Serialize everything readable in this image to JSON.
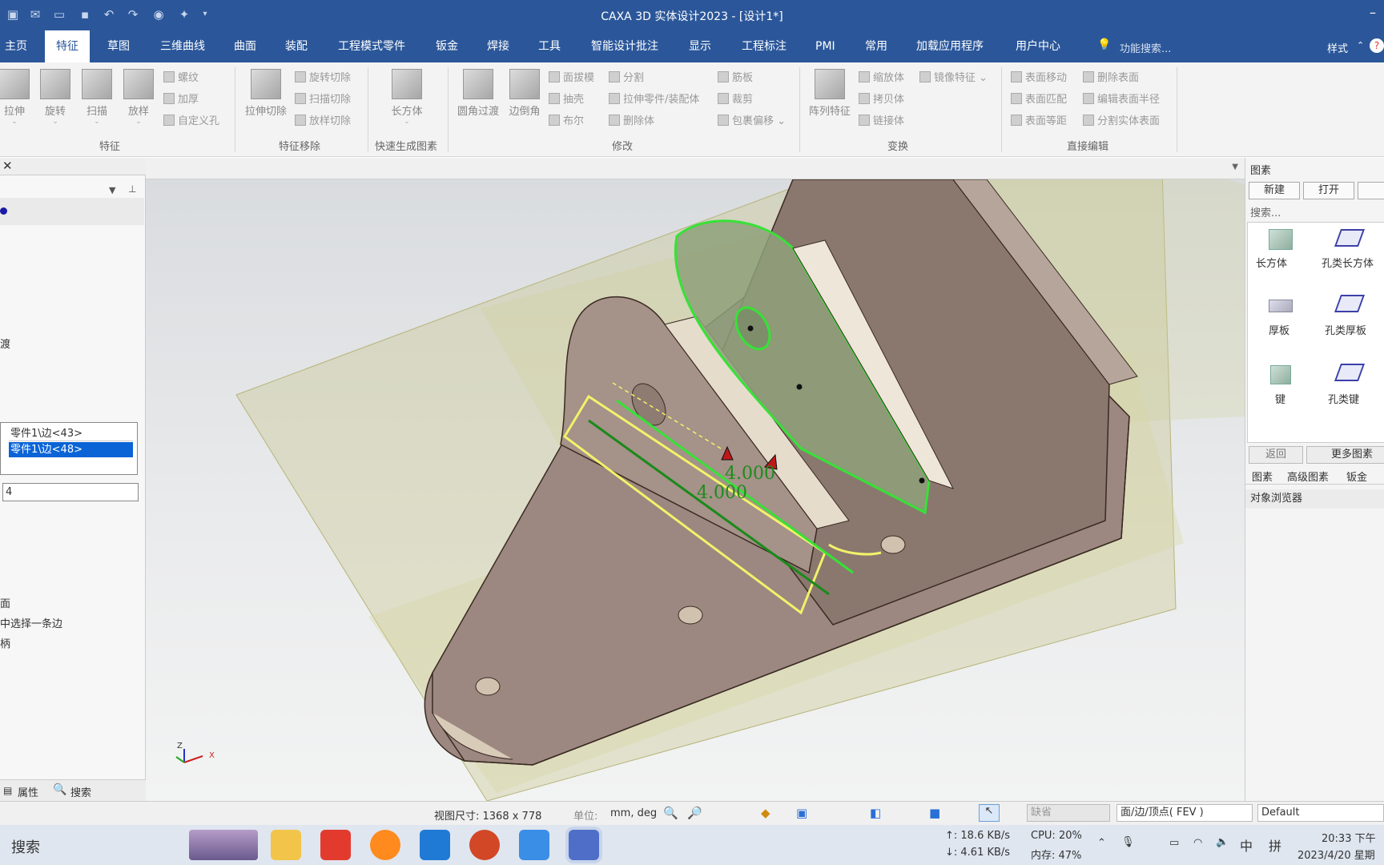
{
  "window": {
    "title": "CAXA 3D 实体设计2023 - [设计1*]"
  },
  "quick_access": [
    "new-icon",
    "mail-icon",
    "open-icon",
    "save-icon",
    "undo-icon",
    "redo-icon",
    "globe-icon",
    "sparkle-icon",
    "dropdown-icon"
  ],
  "tabs": [
    "主页",
    "特征",
    "草图",
    "三维曲线",
    "曲面",
    "装配",
    "工程模式零件",
    "钣金",
    "焊接",
    "工具",
    "智能设计批注",
    "显示",
    "工程标注",
    "PMI",
    "常用",
    "加载应用程序",
    "用户中心"
  ],
  "active_tab": "特征",
  "function_search": "功能搜索...",
  "style_label": "样式",
  "ribbon": {
    "feature": {
      "extrude": "拉伸",
      "revolve": "旋转",
      "sweep": "扫描",
      "loft": "放样",
      "thread": "螺纹",
      "thicken": "加厚",
      "custom_hole": "自定义孔",
      "group": "特征"
    },
    "removal": {
      "extrude_cut": "拉伸切除",
      "revolve_cut": "旋转切除",
      "sweep_cut": "扫描切除",
      "loft_cut": "放样切除",
      "group": "特征移除"
    },
    "quick": {
      "box": "长方体",
      "group": "快速生成图素"
    },
    "modify": {
      "fillet": "圆角过渡",
      "chamfer": "边倒角",
      "draft": "面拔模",
      "shell": "抽壳",
      "boolean": "布尔",
      "split": "分割",
      "extrude_part": "拉伸零件/装配体",
      "delete_body": "删除体",
      "rib": "筋板",
      "trim": "裁剪",
      "wrap": "包裹偏移",
      "group": "修改"
    },
    "transform": {
      "pattern": "阵列特征",
      "scale": "缩放体",
      "copy": "拷贝体",
      "link": "链接体",
      "mirror": "镜像特征",
      "group": "变换"
    },
    "direct": {
      "move_face": "表面移动",
      "match_face": "表面匹配",
      "offset_face": "表面等距",
      "delete_face": "删除表面",
      "edit_radius": "编辑表面半径",
      "split_face": "分割实体表面",
      "group": "直接编辑"
    }
  },
  "left_panel": {
    "partial_label": "渡",
    "edges": [
      "零件1\\边<43>",
      "零件1\\边<48>"
    ],
    "value": "4",
    "hint1": "面",
    "hint2": "中选择一条边",
    "hint3": "柄",
    "tab_props": "属性",
    "tab_search": "搜索"
  },
  "viewport": {
    "dim1": "4.000",
    "dim2": "4.000"
  },
  "right_panel": {
    "title": "图素",
    "new": "新建",
    "open": "打开",
    "search": "搜索...",
    "items": [
      "长方体",
      "孔类长方体",
      "厚板",
      "孔类厚板",
      "键",
      "孔类键"
    ],
    "back": "返回",
    "more": "更多图素",
    "tabs": [
      "图素",
      "高级图素",
      "钣金"
    ],
    "browser": "对象浏览器"
  },
  "status": {
    "view_size": "视图尺寸: 1368 x 778",
    "unit_label": "单位:",
    "unit_value": "mm, deg",
    "mode": "缺省",
    "filter": "面/边/顶点( FEV )",
    "style": "Default"
  },
  "taskbar": {
    "search": "搜索",
    "net_up": "↑: 18.6 KB/s",
    "net_down": "↓: 4.61 KB/s",
    "cpu": "CPU: 20%",
    "mem": "内存: 47%",
    "ime": "中",
    "ime2": "拼",
    "time": "20:33 下午",
    "date": "2023/4/20 星期"
  }
}
